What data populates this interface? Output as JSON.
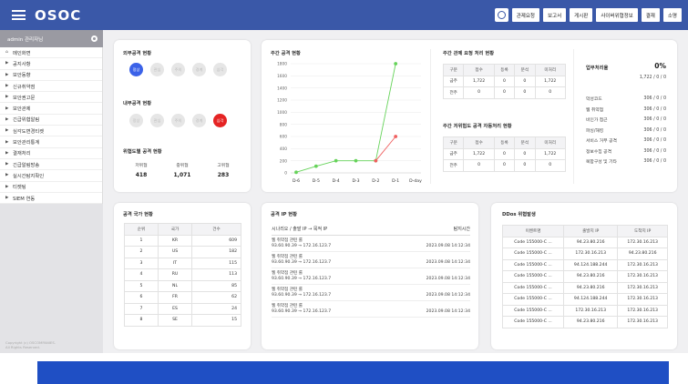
{
  "header": {
    "logo": "OSOC",
    "buttons": [
      "관제요청",
      "보고서",
      "게시판",
      "사이버위협정보",
      "결재",
      "소명"
    ]
  },
  "sidebar": {
    "user": "admin 관리자님",
    "items": [
      "메인화면",
      "공지사항",
      "보안동향",
      "신규취약점",
      "보안권고문",
      "보안관제",
      "긴급위협알림",
      "심각도변경티켓",
      "보안관리통계",
      "결재처리",
      "긴급알림방송",
      "실시간탐지확인",
      "티켓팅",
      "SIEM 연동"
    ],
    "copyright_1": "Copyright (c) OSCOMPANIES.",
    "copyright_2": "All Rights Reserved."
  },
  "external_attack": {
    "title": "외부공격 현황",
    "levels": [
      "정상",
      "관심",
      "주의",
      "경계",
      "심각"
    ],
    "active": "정상"
  },
  "internal_attack": {
    "title": "내부공격 현황",
    "levels": [
      "정상",
      "관심",
      "주의",
      "경계",
      "심각"
    ],
    "active": "심각"
  },
  "threat_level": {
    "title": "위협도별 공격 현황",
    "stats": [
      {
        "label": "저위협",
        "value": "418"
      },
      {
        "label": "중위협",
        "value": "1,071"
      },
      {
        "label": "고위협",
        "value": "283"
      }
    ]
  },
  "weekly_chart": {
    "title": "주간 공격 현황"
  },
  "chart_data": {
    "type": "line",
    "categories": [
      "D-6",
      "D-5",
      "D-4",
      "D-3",
      "D-2",
      "D-1",
      "D-day"
    ],
    "series": [
      {
        "values": [
          10,
          110,
          200,
          200,
          200,
          1800,
          null
        ],
        "color": "#66d35a"
      },
      {
        "values": [
          null,
          null,
          null,
          null,
          200,
          600
        ],
        "color": "#f06060"
      }
    ],
    "yticks": [
      0,
      200,
      400,
      600,
      800,
      1000,
      1200,
      1400,
      1600,
      1800
    ],
    "ylim": [
      0,
      1800
    ]
  },
  "weekly_request": {
    "title": "주간 관제 요청 처리 현황",
    "headers": [
      "구분",
      "접수",
      "등록",
      "분석",
      "미처리"
    ],
    "rows": [
      [
        "금주",
        "1,722",
        "0",
        "0",
        "1,722"
      ],
      [
        "전주",
        "0",
        "0",
        "0",
        "0"
      ]
    ]
  },
  "weekly_auto": {
    "title": "주간 저위험도 공격 자동처리 현황",
    "headers": [
      "구분",
      "접수",
      "등록",
      "분석",
      "미처리"
    ],
    "rows": [
      [
        "금주",
        "1,722",
        "0",
        "0",
        "1,722"
      ],
      [
        "전주",
        "0",
        "0",
        "0",
        "0"
      ]
    ]
  },
  "work_rate": {
    "title": "업무처리율",
    "percent": "0%",
    "summary": "1,722 / 0 / 0",
    "rows": [
      {
        "label": "악성코드",
        "value": "306 / 0 / 0"
      },
      {
        "label": "웹 취약점",
        "value": "306 / 0 / 0"
      },
      {
        "label": "비인가 접근",
        "value": "306 / 0 / 0"
      },
      {
        "label": "파싱/해킹",
        "value": "306 / 0 / 0"
      },
      {
        "label": "서비스 거부 공격",
        "value": "306 / 0 / 0"
      },
      {
        "label": "정보수집 공격",
        "value": "306 / 0 / 0"
      },
      {
        "label": "복합구성 및 기타",
        "value": "306 / 0 / 0"
      }
    ]
  },
  "country": {
    "title": "공격 국가 현황",
    "headers": [
      "순위",
      "국가",
      "건수"
    ],
    "rows": [
      [
        "1",
        "KR",
        "609"
      ],
      [
        "2",
        "US",
        "182"
      ],
      [
        "3",
        "IT",
        "115"
      ],
      [
        "4",
        "RU",
        "113"
      ],
      [
        "5",
        "NL",
        "85"
      ],
      [
        "6",
        "FR",
        "62"
      ],
      [
        "7",
        "ES",
        "24"
      ],
      [
        "8",
        "SE",
        "15"
      ]
    ]
  },
  "attack_ip": {
    "title": "공격 IP 현황",
    "col1": "시나리오 / 출발 IP → 목적 IP",
    "col2": "탐지시간",
    "rows": [
      {
        "scenario": "웹 취약점 관련 룰",
        "src": "93.60.90.39",
        "dst": "172.16.123.7",
        "time": "2023.09.08 14:12:34"
      },
      {
        "scenario": "웹 취약점 관련 룰",
        "src": "93.60.90.39",
        "dst": "172.16.123.7",
        "time": "2023.09.08 14:12:34"
      },
      {
        "scenario": "웹 취약점 관련 룰",
        "src": "93.60.90.39",
        "dst": "172.16.123.7",
        "time": "2023.09.08 14:12:34"
      },
      {
        "scenario": "웹 취약점 관련 룰",
        "src": "93.60.90.39",
        "dst": "172.16.123.7",
        "time": "2023.09.08 14:12:34"
      },
      {
        "scenario": "웹 취약점 관련 룰",
        "src": "93.60.90.39",
        "dst": "172.16.123.7",
        "time": "2023.09.08 14:12:34"
      }
    ]
  },
  "ddos": {
    "title": "DDos 위협발생",
    "headers": [
      "이벤트명",
      "출발지 IP",
      "도착지 IP"
    ],
    "rows": [
      [
        "Code 155000-C ...",
        "94.23.80.216",
        "172.30.16.213"
      ],
      [
        "Code 155000-C ...",
        "172.30.16.213",
        "94.23.80.216"
      ],
      [
        "Code 155000-C ...",
        "94.124.188.244",
        "172.30.16.213"
      ],
      [
        "Code 155000-C ...",
        "94.23.80.216",
        "172.30.16.213"
      ],
      [
        "Code 155000-C ...",
        "94.23.80.216",
        "172.30.16.213"
      ],
      [
        "Code 155000-C ...",
        "94.124.188.244",
        "172.30.16.213"
      ],
      [
        "Code 155000-C ...",
        "172.30.16.213",
        "172.30.16.213"
      ],
      [
        "Code 155000-C ...",
        "94.23.80.216",
        "172.30.16.213"
      ]
    ]
  }
}
